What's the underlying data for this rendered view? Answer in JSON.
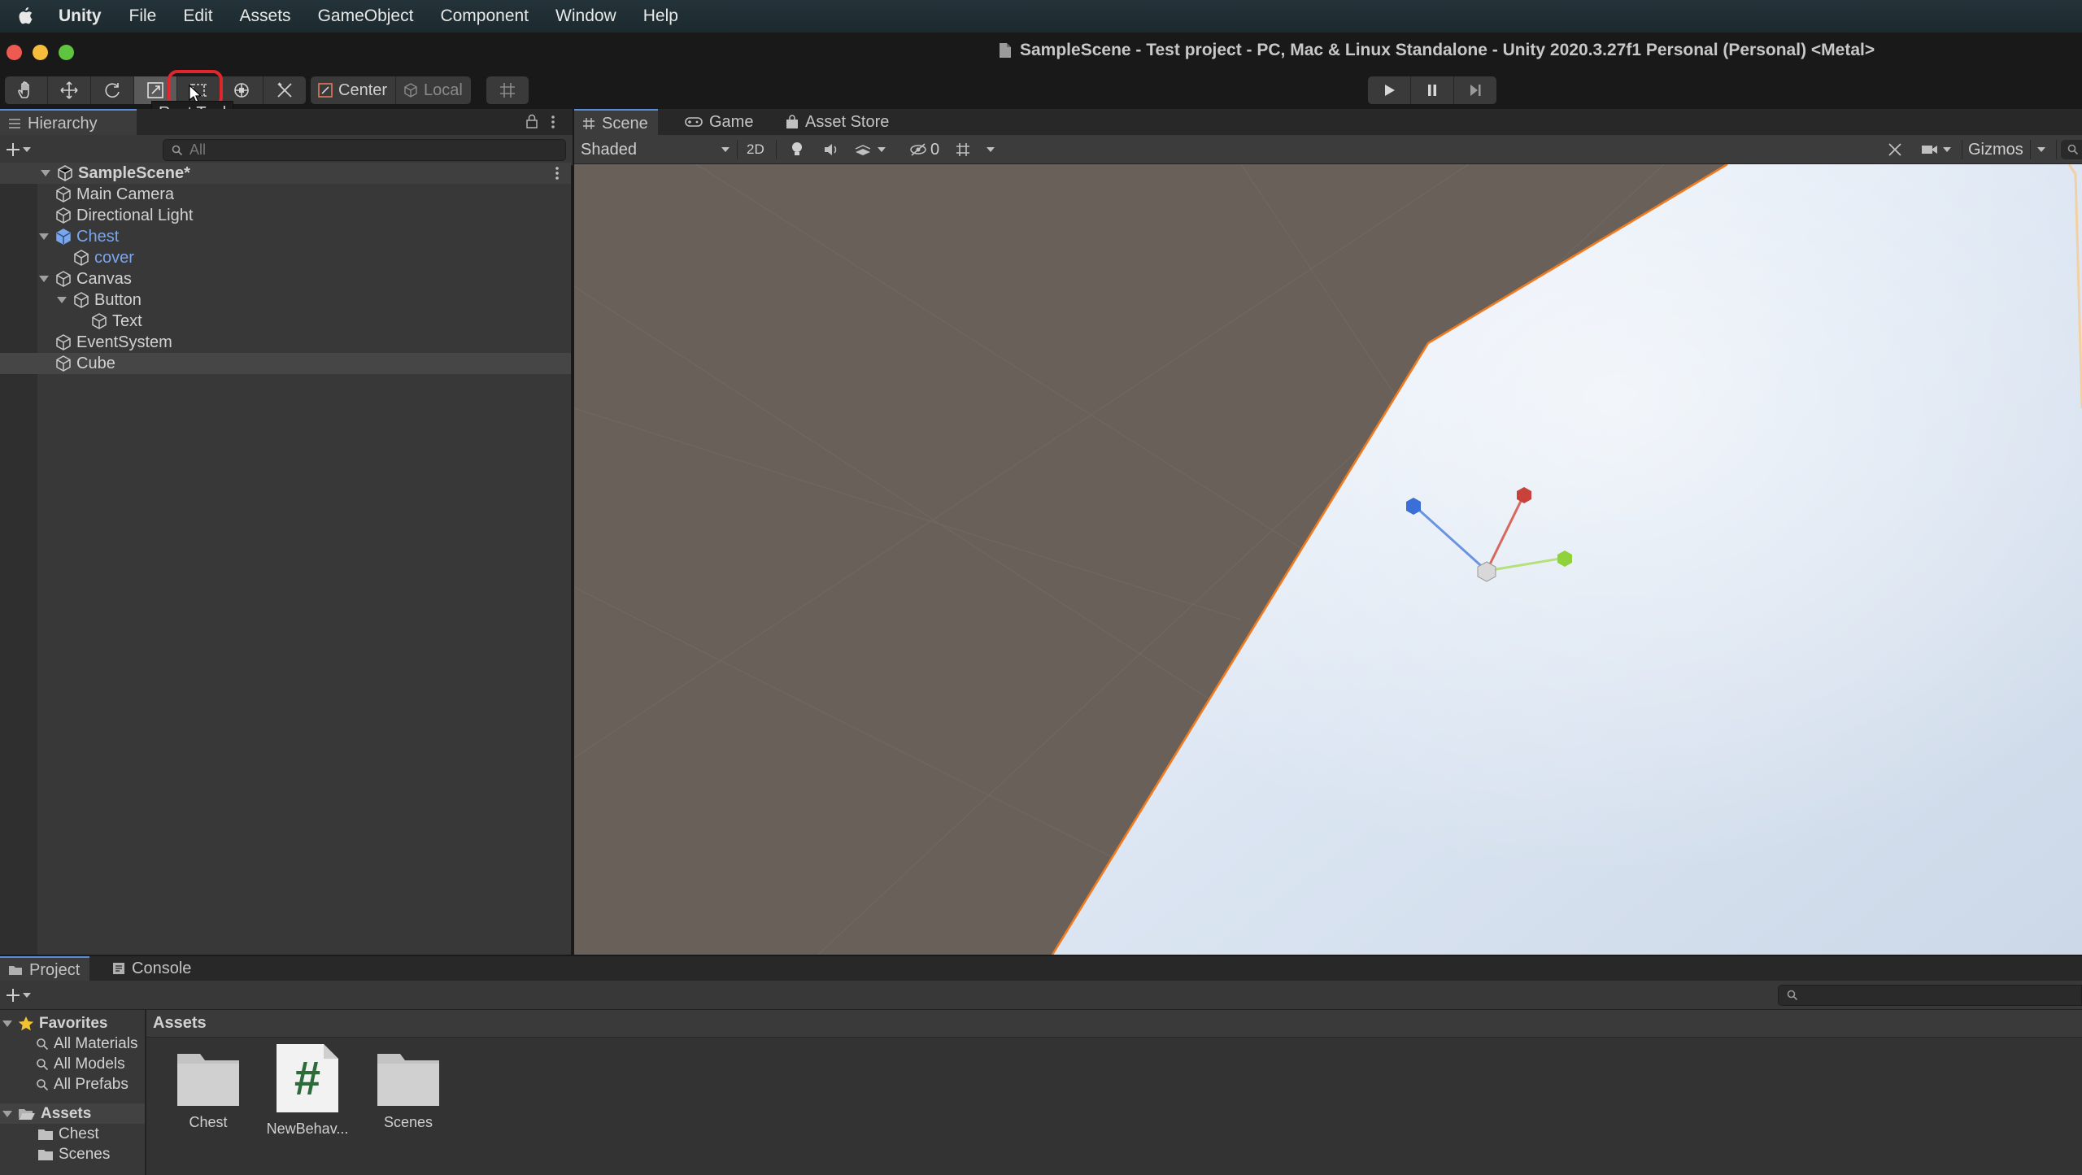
{
  "menubar": {
    "app_name": "Unity",
    "items": [
      "File",
      "Edit",
      "Assets",
      "GameObject",
      "Component",
      "Window",
      "Help"
    ]
  },
  "window": {
    "title": "SampleScene - Test project - PC, Mac & Linux Standalone - Unity 2020.3.27f1 Personal (Personal) <Metal>"
  },
  "toolbar": {
    "tools": [
      "hand-tool",
      "move-tool",
      "rotate-tool",
      "scale-tool",
      "rect-tool",
      "transform-tool",
      "custom-editor-tool"
    ],
    "active_tool": "scale-tool",
    "tooltip": "Rect Tool",
    "pivot_mode": "Center",
    "pivot_rotation": "Local"
  },
  "hierarchy": {
    "tab_label": "Hierarchy",
    "search_placeholder": "All",
    "scene_name": "SampleScene*",
    "items": [
      {
        "label": "Main Camera",
        "depth": 1,
        "fold": "none",
        "kind": "gameobject"
      },
      {
        "label": "Directional Light",
        "depth": 1,
        "fold": "none",
        "kind": "gameobject"
      },
      {
        "label": "Chest",
        "depth": 1,
        "fold": "open",
        "kind": "prefab"
      },
      {
        "label": "cover",
        "depth": 2,
        "fold": "none",
        "kind": "prefab-child"
      },
      {
        "label": "Canvas",
        "depth": 1,
        "fold": "open",
        "kind": "gameobject"
      },
      {
        "label": "Button",
        "depth": 2,
        "fold": "open",
        "kind": "gameobject"
      },
      {
        "label": "Text",
        "depth": 3,
        "fold": "none",
        "kind": "gameobject"
      },
      {
        "label": "EventSystem",
        "depth": 1,
        "fold": "none",
        "kind": "gameobject"
      },
      {
        "label": "Cube",
        "depth": 1,
        "fold": "none",
        "kind": "gameobject",
        "selected": true
      }
    ]
  },
  "scene": {
    "tabs": [
      "Scene",
      "Game",
      "Asset Store"
    ],
    "draw_mode": "Shaded",
    "mode_2d": "2D",
    "hidden_count": "0",
    "gizmos_label": "Gizmos"
  },
  "project": {
    "tabs": [
      "Project",
      "Console"
    ],
    "favorites_label": "Favorites",
    "favorites": [
      "All Materials",
      "All Models",
      "All Prefabs"
    ],
    "assets_label": "Assets",
    "asset_folders": [
      "Chest",
      "Scenes"
    ],
    "breadcrumb": "Assets",
    "grid_items": [
      {
        "label": "Chest",
        "kind": "folder"
      },
      {
        "label": "NewBehav...",
        "kind": "script"
      },
      {
        "label": "Scenes",
        "kind": "folder"
      }
    ]
  },
  "colors": {
    "selection_ring": "#e0262d",
    "prefab_blue": "#7aa6ee",
    "selection_outline": "#f07a1e",
    "axis_x": "#c8413a",
    "axis_y": "#8fd23c",
    "axis_z": "#3a6fd8"
  }
}
